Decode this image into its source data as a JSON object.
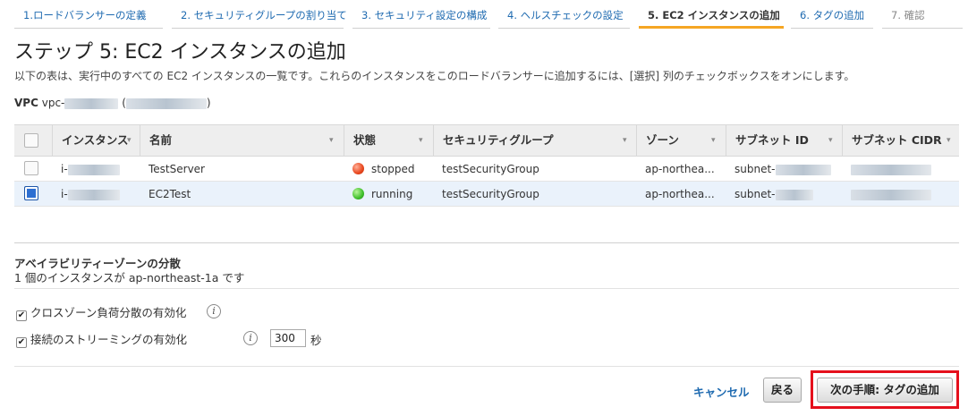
{
  "tabs": [
    {
      "label": "1.ロードバランサーの定義",
      "state": "done"
    },
    {
      "label": "2. セキュリティグループの割り当て",
      "state": "done"
    },
    {
      "label": "3. セキュリティ設定の構成",
      "state": "done"
    },
    {
      "label": "4. ヘルスチェックの設定",
      "state": "done"
    },
    {
      "label": "5. EC2 インスタンスの追加",
      "state": "active"
    },
    {
      "label": "6. タグの追加",
      "state": "done"
    },
    {
      "label": "7. 確認",
      "state": "future"
    }
  ],
  "page": {
    "title": "ステップ 5: EC2 インスタンスの追加",
    "description": "以下の表は、実行中のすべての EC2 インスタンスの一覧です。これらのインスタンスをこのロードバランサーに追加するには、[選択] 列のチェックボックスをオンにします。"
  },
  "vpc": {
    "label": "VPC",
    "prefix": "vpc-",
    "paren_open": "(",
    "paren_close": ")"
  },
  "table": {
    "columns": [
      "インスタンス",
      "名前",
      "状態",
      "セキュリティグループ",
      "ゾーン",
      "サブネット ID",
      "サブネット CIDR"
    ],
    "rows": [
      {
        "instance": "i-",
        "name": "TestServer",
        "state": "stopped",
        "security_group": "testSecurityGroup",
        "zone": "ap-northea...",
        "subnet": "subnet-",
        "selected": false
      },
      {
        "instance": "i-",
        "name": "EC2Test",
        "state": "running",
        "security_group": "testSecurityGroup",
        "zone": "ap-northea...",
        "subnet": "subnet-",
        "selected": true
      }
    ]
  },
  "availability": {
    "title": "アベイラビリティーゾーンの分散",
    "text": "1 個のインスタンスが ap-northeast-1a です"
  },
  "options": {
    "cross_zone_label": "クロスゾーン負荷分散の有効化",
    "streaming_label": "接続のストリーミングの有効化",
    "timeout_value": "300",
    "seconds_label": "秒",
    "info_glyph": "i"
  },
  "footer": {
    "cancel_label": "キャンセル",
    "back_label": "戻る",
    "next_label": "次の手順: タグの追加"
  },
  "colors": {
    "link": "#1e6ab0",
    "active_tab_underline": "#f5a623",
    "stopped": "#e8461e",
    "running": "#3fbf2a",
    "highlight_frame": "#e5101c",
    "selected_row": "#eaf2fb"
  }
}
